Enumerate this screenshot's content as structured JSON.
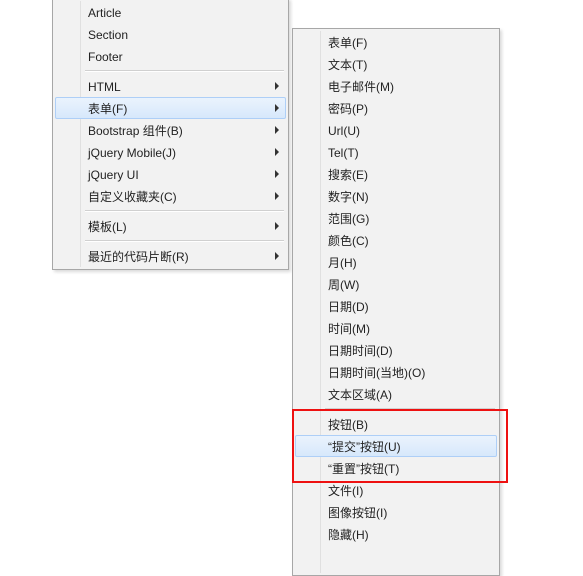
{
  "leftMenu": {
    "items_top": [
      {
        "label": "Article",
        "name": "menu-item-article"
      },
      {
        "label": "Section",
        "name": "menu-item-section"
      },
      {
        "label": "Footer",
        "name": "menu-item-footer"
      }
    ],
    "items_mid": [
      {
        "label": "HTML",
        "name": "menu-item-html",
        "sub": true
      },
      {
        "label": "表单(F)",
        "name": "menu-item-form",
        "sub": true,
        "hover": true
      },
      {
        "label": "Bootstrap 组件(B)",
        "name": "menu-item-bootstrap",
        "sub": true
      },
      {
        "label": "jQuery Mobile(J)",
        "name": "menu-item-jquery-mobile",
        "sub": true
      },
      {
        "label": "jQuery UI",
        "name": "menu-item-jquery-ui",
        "sub": true
      },
      {
        "label": "自定义收藏夹(C)",
        "name": "menu-item-custom-fav",
        "sub": true
      }
    ],
    "items_tmpl": [
      {
        "label": "模板(L)",
        "name": "menu-item-templates",
        "sub": true
      }
    ],
    "items_bottom": [
      {
        "label": "最近的代码片断(R)",
        "name": "menu-item-recent-snippets",
        "sub": true
      }
    ]
  },
  "rightMenu": {
    "group1": [
      {
        "label": "表单(F)",
        "name": "menu-item-r-form"
      },
      {
        "label": "文本(T)",
        "name": "menu-item-r-text"
      },
      {
        "label": "电子邮件(M)",
        "name": "menu-item-r-email"
      },
      {
        "label": "密码(P)",
        "name": "menu-item-r-password"
      },
      {
        "label": "Url(U)",
        "name": "menu-item-r-url"
      },
      {
        "label": "Tel(T)",
        "name": "menu-item-r-tel"
      },
      {
        "label": "搜索(E)",
        "name": "menu-item-r-search"
      },
      {
        "label": "数字(N)",
        "name": "menu-item-r-number"
      },
      {
        "label": "范围(G)",
        "name": "menu-item-r-range"
      },
      {
        "label": "颜色(C)",
        "name": "menu-item-r-color"
      },
      {
        "label": "月(H)",
        "name": "menu-item-r-month"
      },
      {
        "label": "周(W)",
        "name": "menu-item-r-week"
      },
      {
        "label": "日期(D)",
        "name": "menu-item-r-date"
      },
      {
        "label": "时间(M)",
        "name": "menu-item-r-time"
      },
      {
        "label": "日期时间(D)",
        "name": "menu-item-r-datetime"
      },
      {
        "label": "日期时间(当地)(O)",
        "name": "menu-item-r-datetime-local"
      },
      {
        "label": "文本区域(A)",
        "name": "menu-item-r-textarea"
      }
    ],
    "group2": [
      {
        "label": "按钮(B)",
        "name": "menu-item-r-button"
      },
      {
        "label": "“提交”按钮(U)",
        "name": "menu-item-r-submit-button",
        "hover": true
      },
      {
        "label": "“重置”按钮(T)",
        "name": "menu-item-r-reset-button"
      },
      {
        "label": "文件(I)",
        "name": "menu-item-r-file"
      },
      {
        "label": "图像按钮(I)",
        "name": "menu-item-r-image-button"
      },
      {
        "label": "隐藏(H)",
        "name": "menu-item-r-hidden"
      }
    ]
  },
  "highlight": {
    "color": "#e11"
  }
}
